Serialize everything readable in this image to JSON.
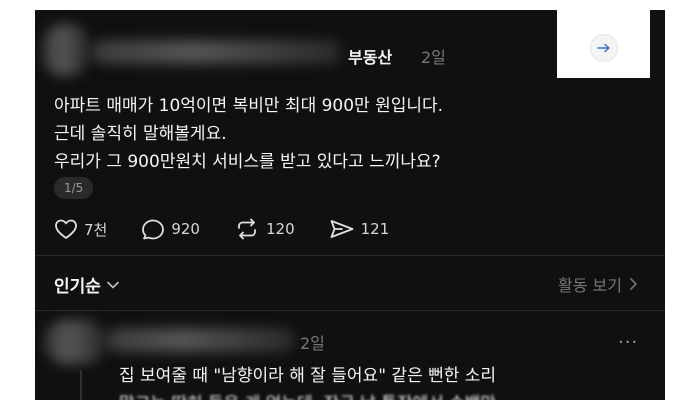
{
  "post": {
    "author_hidden": true,
    "topic": "부동산",
    "time": "2일",
    "body_lines": [
      "아파트 매매가 10억이면 복비만 최대 900만 원입니다.",
      "근데 솔직히 말해볼게요.",
      "우리가 그 900만원치 서비스를 받고 있다고 느끼나요?"
    ],
    "page_indicator": "1/5",
    "actions": {
      "likes": "7천",
      "comments": "920",
      "reposts": "120",
      "shares": "121"
    },
    "share_icon": "arrow-right-icon"
  },
  "replies_header": {
    "sort_label": "인기순",
    "activity_label": "활동 보기"
  },
  "comment": {
    "author_hidden": true,
    "time": "2일",
    "more": "···",
    "line1": "집 보여줄 때 \"남향이라 해 잘 들어요\" 같은 뻔한 소리",
    "line2": "말고는 딱히 들은 게 없는데, 잔금 날 통장에서 수백만"
  },
  "colors": {
    "background": "#101010",
    "text_primary": "#f3f5f7",
    "text_secondary": "#777777"
  }
}
